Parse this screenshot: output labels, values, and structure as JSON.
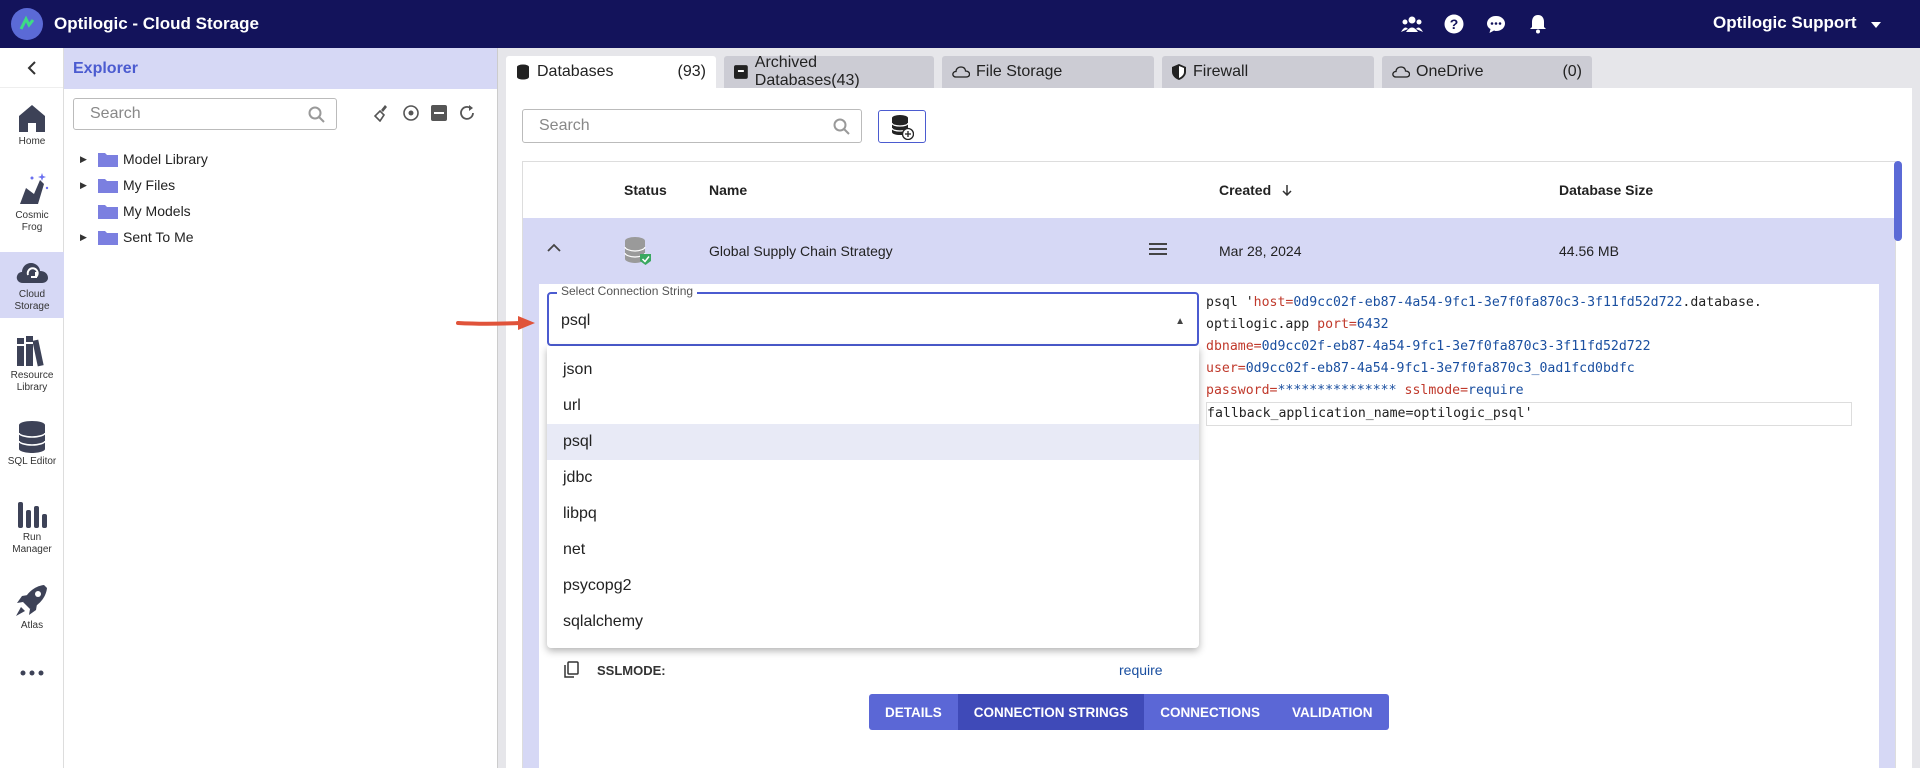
{
  "app": {
    "title": "Optilogic - Cloud Storage",
    "user": "Optilogic Support"
  },
  "topbar": {
    "icons": [
      "people-icon",
      "help-icon",
      "chat-icon",
      "bell-icon"
    ]
  },
  "leftnav": {
    "items": [
      {
        "label": "Home",
        "icon": "home-icon"
      },
      {
        "label": "Cosmic Frog",
        "icon": "frog-icon"
      },
      {
        "label": "Cloud Storage",
        "icon": "cloud-icon"
      },
      {
        "label": "Resource Library",
        "icon": "library-icon"
      },
      {
        "label": "SQL Editor",
        "icon": "database-icon"
      },
      {
        "label": "Run Manager",
        "icon": "bars-icon"
      },
      {
        "label": "Atlas",
        "icon": "rocket-icon"
      }
    ]
  },
  "explorer": {
    "title": "Explorer",
    "search_placeholder": "Search",
    "tree": [
      {
        "label": "Model Library"
      },
      {
        "label": "My Files"
      },
      {
        "label": "My Models"
      },
      {
        "label": "Sent To Me"
      }
    ]
  },
  "tabs": [
    {
      "label": "Databases",
      "count": "(93)"
    },
    {
      "label": "Archived Databases(43)",
      "count": ""
    },
    {
      "label": "File Storage",
      "count": ""
    },
    {
      "label": "Firewall",
      "count": ""
    },
    {
      "label": "OneDrive",
      "count": "(0)"
    }
  ],
  "db": {
    "search_placeholder": "Search",
    "columns": {
      "status": "Status",
      "name": "Name",
      "created": "Created",
      "size": "Database Size"
    },
    "row": {
      "name": "Global Supply Chain Strategy",
      "created": "Mar 28, 2024",
      "size": "44.56 MB"
    }
  },
  "connection": {
    "select_label": "Select Connection String",
    "selected": "psql",
    "options": [
      "json",
      "url",
      "psql",
      "jdbc",
      "libpq",
      "net",
      "psycopg2",
      "sqlalchemy"
    ],
    "string": {
      "prefix": "psql '",
      "host_key": "host=",
      "host_a": "0d9cc02f-eb87-4a54-9fc1-3e7f0fa870c3-3f11fd52d722",
      "host_b": ".database.",
      "host_c": "optilogic.app",
      "port_key": " port=",
      "port_val": "6432",
      "dbname_key": "dbname=",
      "dbname_val": "0d9cc02f-eb87-4a54-9fc1-3e7f0fa870c3-3f11fd52d722",
      "user_key": "user=",
      "user_val": "0d9cc02f-eb87-4a54-9fc1-3e7f0fa870c3_0ad1fcd0bdfc",
      "password_key": "password=",
      "password_val": "***************",
      "sslmode_key": " sslmode=",
      "sslmode_val": "require",
      "fallback": "fallback_application_name=optilogic_psql'"
    }
  },
  "sslmode": {
    "label": "SSLMODE:",
    "value": "require"
  },
  "buttons": {
    "details": "DETAILS",
    "connection_strings": "CONNECTION STRINGS",
    "connections": "CONNECTIONS",
    "validation": "VALIDATION"
  },
  "colors": {
    "topbar": "#13135b",
    "accent": "#4b5bd0",
    "highlight": "#d6d8f5",
    "arrow": "#e0533a"
  }
}
